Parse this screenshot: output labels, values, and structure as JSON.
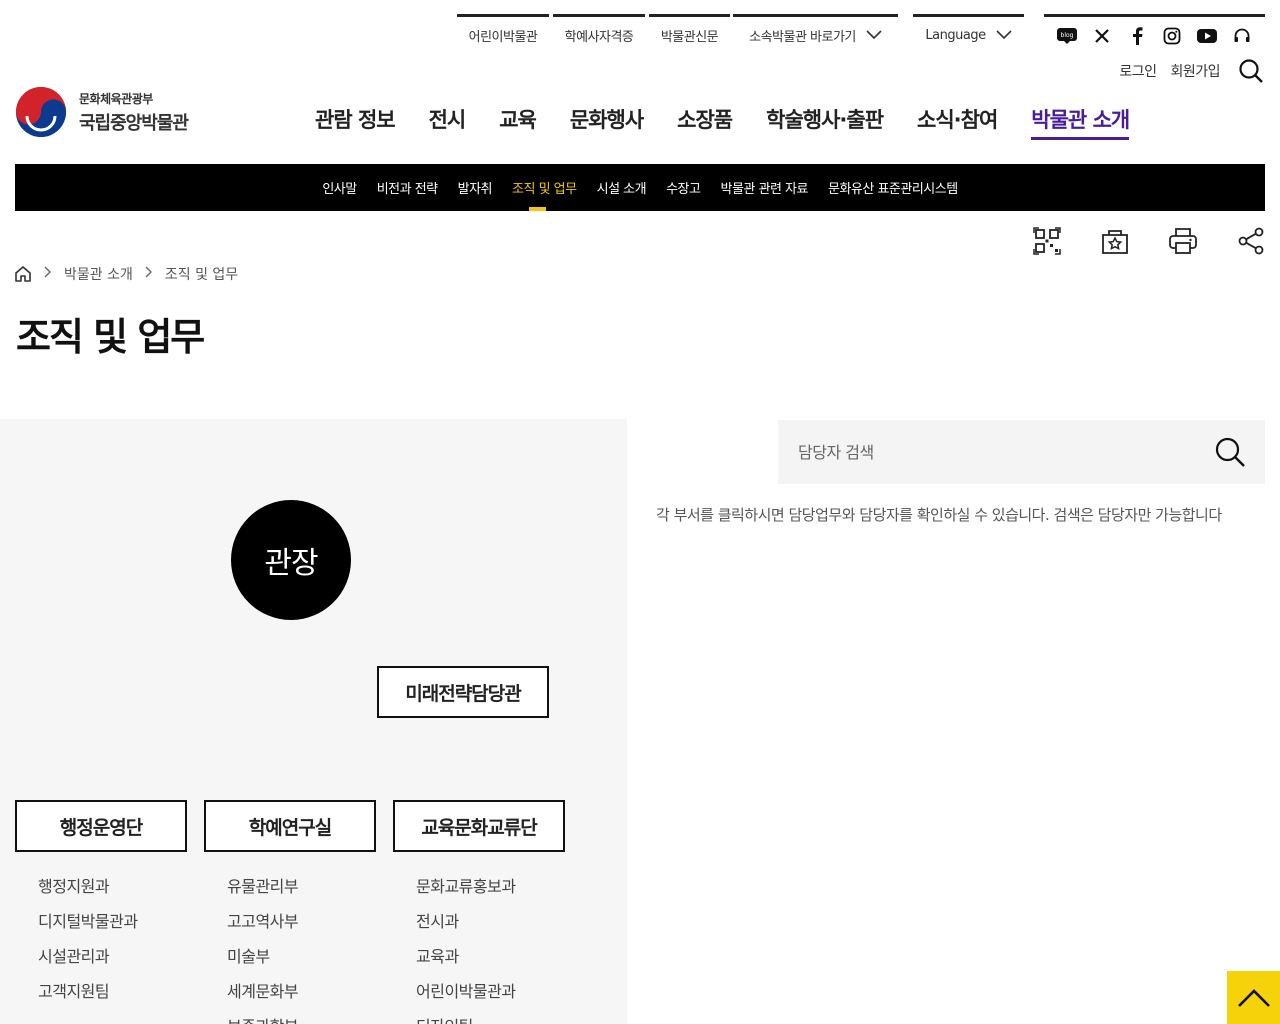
{
  "util": {
    "links": [
      "어린이박물관",
      "학예사자격증",
      "박물관신문"
    ],
    "affiliates": "소속박물관 바로가기",
    "language": "Language"
  },
  "social": [
    "blog-icon",
    "x-icon",
    "facebook-icon",
    "instagram-icon",
    "youtube-icon",
    "headset-icon"
  ],
  "login": {
    "login": "로그인",
    "signup": "회원가입"
  },
  "logo": {
    "ministry": "문화체육관광부",
    "name": "국립중앙박물관"
  },
  "gnb": [
    "관람 정보",
    "전시",
    "교육",
    "문화행사",
    "소장품",
    "학술행사·출판",
    "소식·참여",
    "박물관 소개"
  ],
  "gnb_active_index": 7,
  "subnav": [
    "인사말",
    "비전과 전략",
    "발자취",
    "조직 및 업무",
    "시설 소개",
    "수장고",
    "박물관 관련 자료",
    "문화유산 표준관리시스템"
  ],
  "subnav_active_index": 3,
  "breadcrumb": [
    "박물관 소개",
    "조직 및 업무"
  ],
  "page_title": "조직 및 업무",
  "org": {
    "director": "관장",
    "future": "미래전략담당관",
    "depts": [
      {
        "name": "행정운영단",
        "subs": [
          "행정지원과",
          "디지털박물관과",
          "시설관리과",
          "고객지원팀"
        ]
      },
      {
        "name": "학예연구실",
        "subs": [
          "유물관리부",
          "고고역사부",
          "미술부",
          "세계문화부",
          "보존과학부"
        ]
      },
      {
        "name": "교육문화교류단",
        "subs": [
          "문화교류홍보과",
          "전시과",
          "교육과",
          "어린이박물관과",
          "디자인팀"
        ]
      }
    ]
  },
  "search": {
    "placeholder": "담당자 검색"
  },
  "guide": "각 부서를 클릭하시면 담당업무와 담당자를 확인하실 수 있습니다. 검색은 담당자만 가능합니다",
  "colors": {
    "accent": "#4a1d96",
    "subnav_active": "#f5c518",
    "totop": "#f5d20a"
  }
}
